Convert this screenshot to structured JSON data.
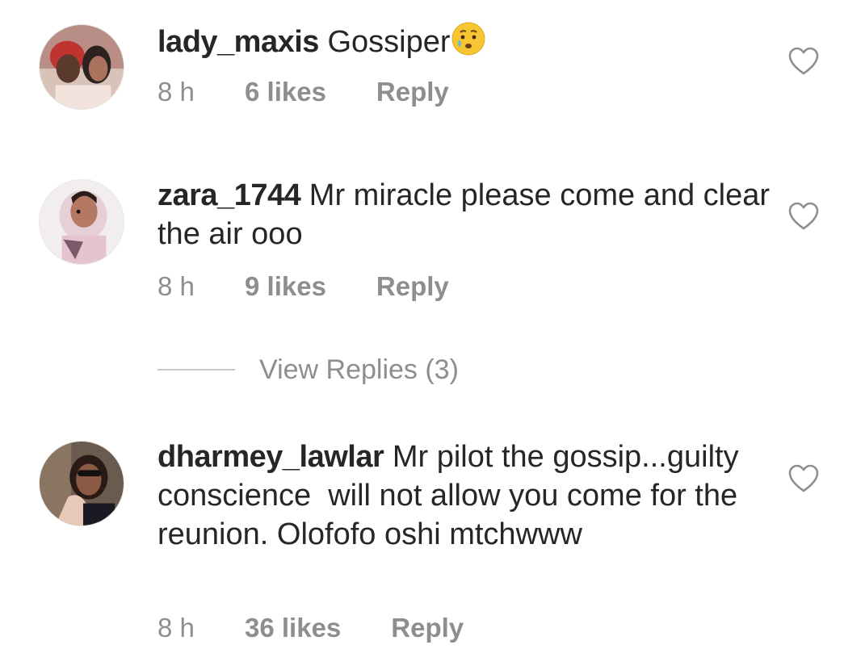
{
  "comments": [
    {
      "username": "lady_maxis",
      "text": " Gossiper",
      "emoji": "sad-tear-emoji",
      "time": "8 h",
      "likes": "6 likes",
      "reply": "Reply"
    },
    {
      "username": "zara_1744",
      "text": " Mr miracle please come and clear the air ooo",
      "time": "8 h",
      "likes": "9 likes",
      "reply": "Reply"
    },
    {
      "username": "dharmey_lawlar",
      "text": " Mr pilot the gossip...guilty conscience  will not allow you come for the reunion. Olofofo oshi mtchwww",
      "time": "8 h",
      "likes": "36 likes",
      "reply": "Reply"
    }
  ],
  "view_replies": {
    "label": "View Replies (3)"
  },
  "icons": {
    "like": "heart-outline-icon"
  },
  "colors": {
    "primary_text": "#262626",
    "secondary_text": "#8e8e8e",
    "divider": "#c7c7c7"
  }
}
